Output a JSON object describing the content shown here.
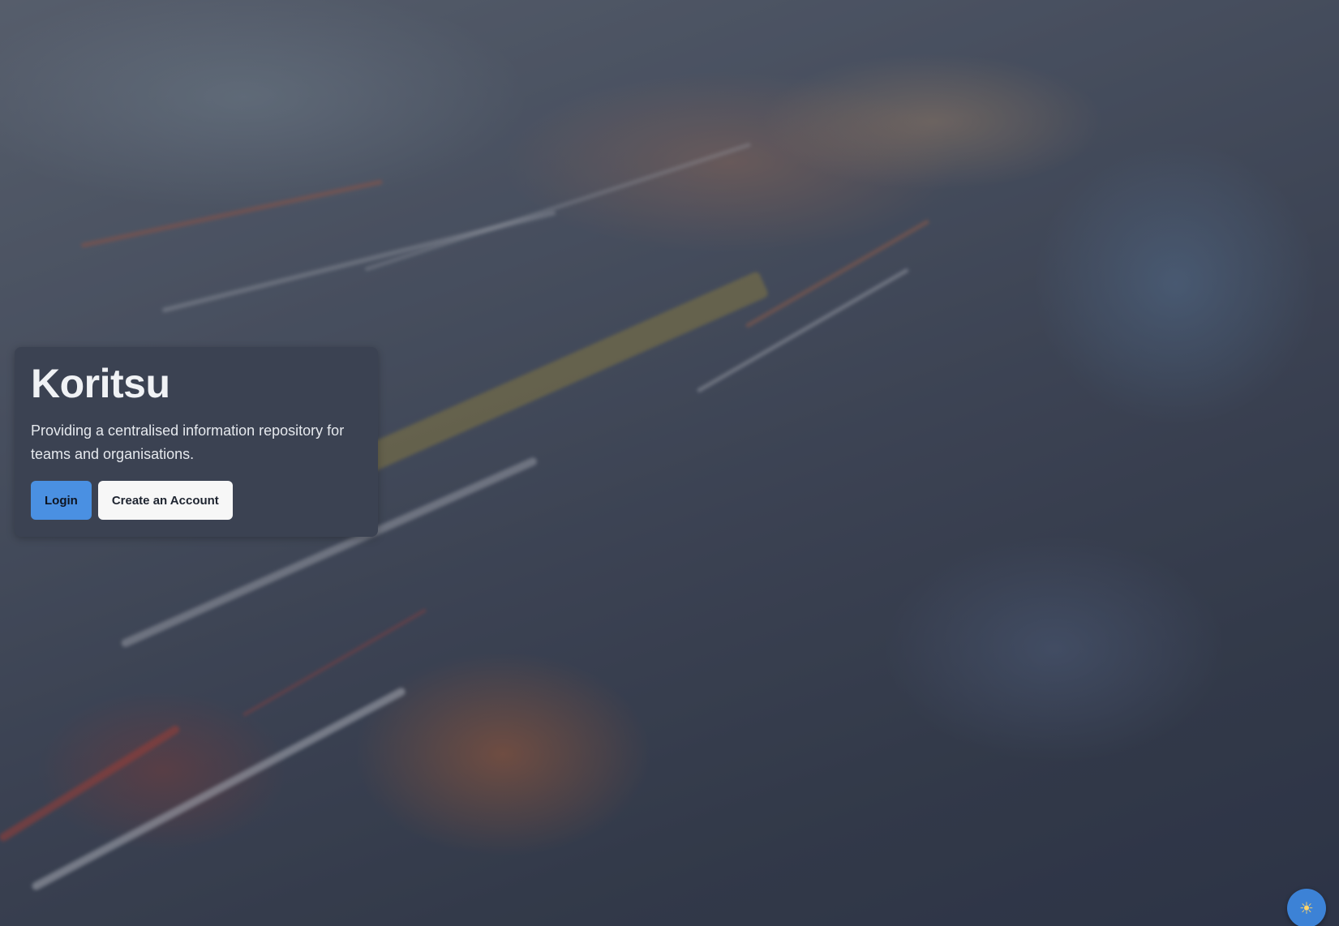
{
  "hero": {
    "title": "Koritsu",
    "description": "Providing a centralised information repository for teams and organisations.",
    "login_label": "Login",
    "create_account_label": "Create an Account"
  },
  "theme_toggle": {
    "icon": "sun-icon",
    "glyph": "☀"
  },
  "colors": {
    "primary": "#4a90e2",
    "card_bg": "#3b4252",
    "toggle_bg": "#3c82d6"
  }
}
